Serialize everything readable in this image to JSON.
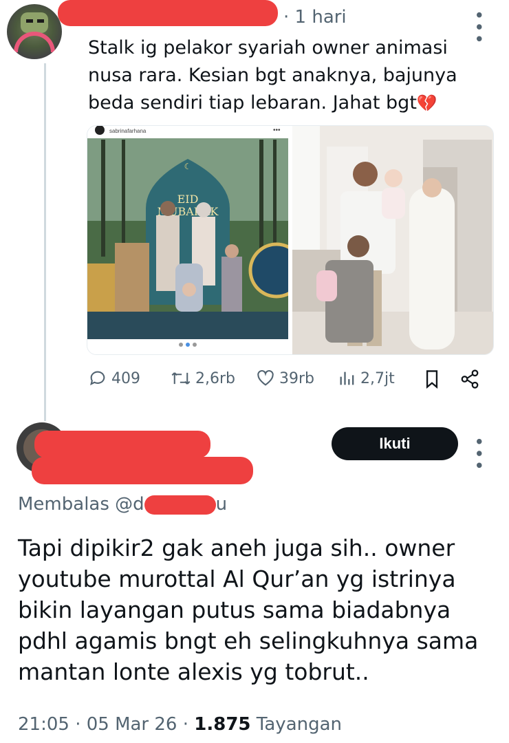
{
  "tweet": {
    "time": "· 1 hari",
    "text": "Stalk ig pelakor syariah owner animasi\nnusa rara. Kesian bgt anaknya, bajunya\nbeda sendiri tiap lebaran. Jahat bgt",
    "emoji": "💔",
    "media": {
      "left_caption": "sabrinafarhana",
      "sign_line1": "EID",
      "sign_line2": "MUBARAK"
    },
    "actions": {
      "replies": "409",
      "retweets": "2,6rb",
      "likes": "39rb",
      "views": "2,7jt"
    }
  },
  "reply": {
    "follow_label": "Ikuti",
    "replying_prefix": "Membalas @d",
    "replying_suffix": "u",
    "text": "Tapi dipikir2 gak aneh juga sih.. owner\nyoutube murottal Al Qur’an yg istrinya\nbikin layangan putus sama biadabnya\npdhl agamis bngt eh selingkuhnya sama\nmantan lonte alexis yg tobrut..",
    "time": "21:05 · 05 Mar 26 · ",
    "views_count": "1.875",
    "views_label": " Tayangan"
  },
  "colors": {
    "text": "#0f1419",
    "secondary": "#536471",
    "redaction": "#ee4040",
    "follow_bg": "#0f1419"
  }
}
